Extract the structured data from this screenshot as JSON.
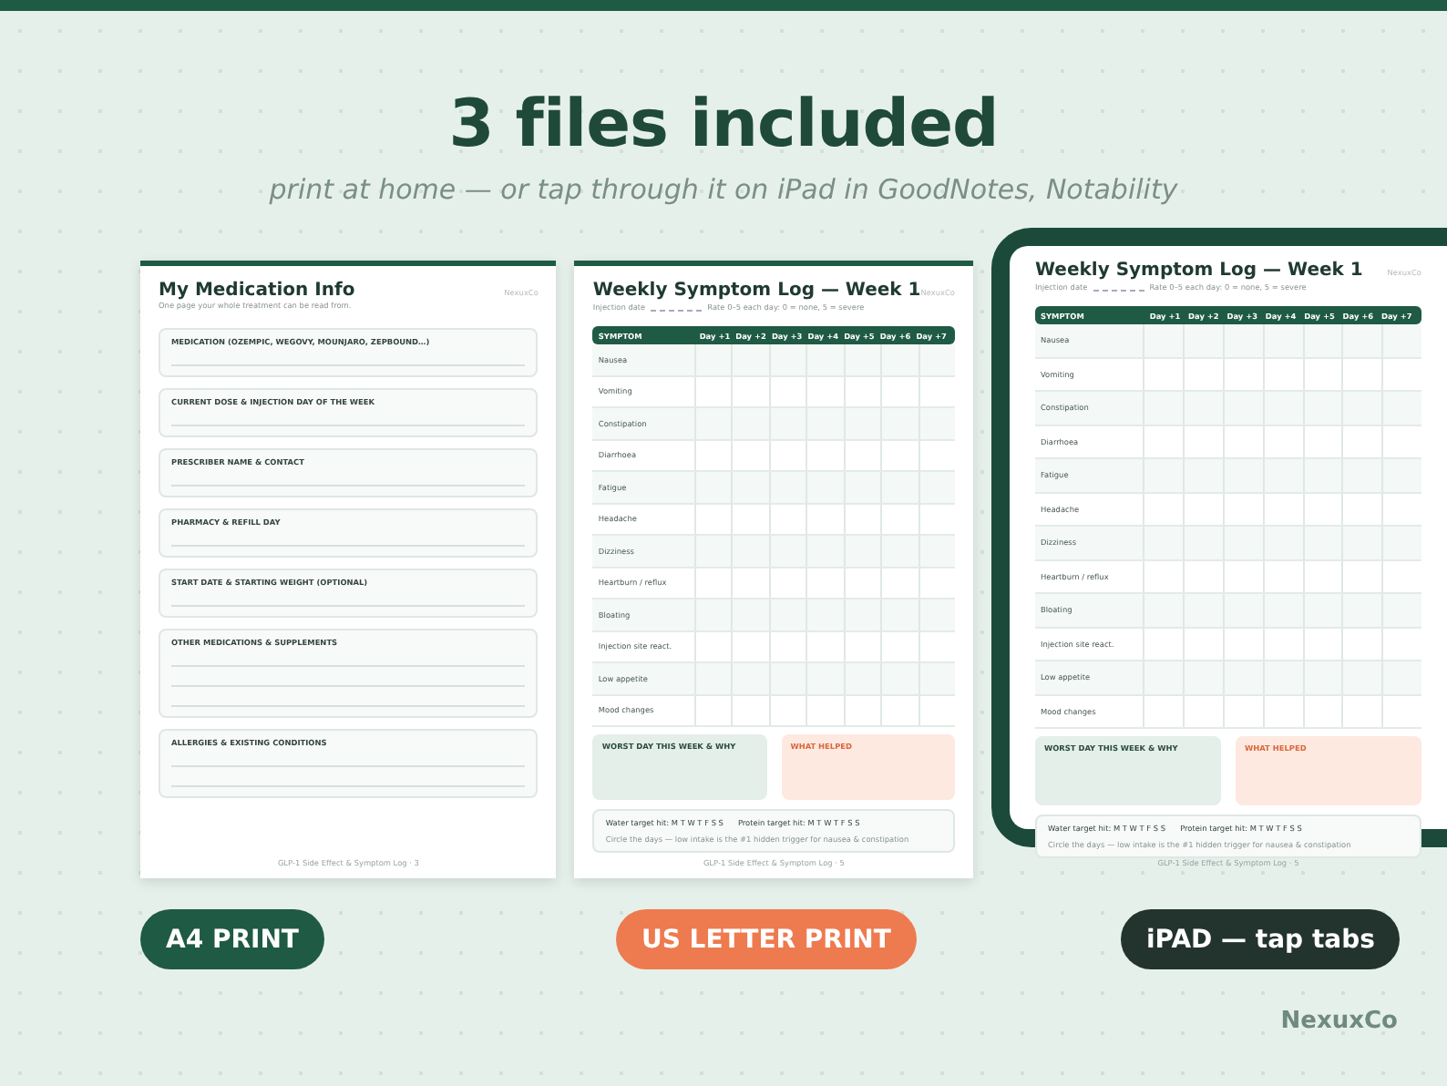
{
  "heading": {
    "title": "3 files included",
    "subtitle": "print at home — or tap through it on iPad in GoodNotes, Notability"
  },
  "pages": [
    {
      "kind": "info",
      "tag": "NexuxCo",
      "title": "My Medication Info",
      "subtitle": "One page your whole treatment can be read from.",
      "fields": [
        {
          "label": "MEDICATION (OZEMPIC, WEGOVY, MOUNJARO, ZEPBOUND…)",
          "kind": "short"
        },
        {
          "label": "CURRENT DOSE & INJECTION DAY OF THE WEEK",
          "kind": "short"
        },
        {
          "label": "PRESCRIBER NAME & CONTACT",
          "kind": "short"
        },
        {
          "label": "PHARMACY & REFILL DAY",
          "kind": "short"
        },
        {
          "label": "START DATE & STARTING WEIGHT (OPTIONAL)",
          "kind": "short"
        },
        {
          "label": "OTHER MEDICATIONS & SUPPLEMENTS",
          "kind": "long"
        },
        {
          "label": "ALLERGIES & EXISTING CONDITIONS",
          "kind": "medium"
        }
      ],
      "footer": "GLP-1 Side Effect & Symptom Log · 3"
    },
    {
      "kind": "log",
      "tag": "NexuxCo",
      "title": "Weekly Symptom Log — Week 1",
      "date_label": "Injection date",
      "rate_note": "Rate 0–5 each day: 0 = none, 5 = severe",
      "columns": [
        "SYMPTOM",
        "Day +1",
        "Day +2",
        "Day +3",
        "Day +4",
        "Day +5",
        "Day +6",
        "Day +7"
      ],
      "rows": [
        "Nausea",
        "Vomiting",
        "Constipation",
        "Diarrhoea",
        "Fatigue",
        "Headache",
        "Dizziness",
        "Heartburn / reflux",
        "Bloating",
        "Injection site react.",
        "Low appetite",
        "Mood changes"
      ],
      "boxes": [
        {
          "title": "WORST DAY THIS WEEK & WHY",
          "color": "#e3efe8"
        },
        {
          "title": "WHAT HELPED",
          "color": "#fde9df"
        }
      ],
      "targets": [
        "Water target hit: M T W T F S S",
        "Protein target hit: M T W T F S S"
      ],
      "note": "Circle the days — low intake is the #1 hidden trigger for nausea & constipation",
      "footer": "GLP-1 Side Effect & Symptom Log · 5"
    },
    {
      "kind": "tablet_log",
      "tag": "NexuxCo",
      "title": "Weekly Symptom Log — Week 1",
      "date_label": "Injection date",
      "rate_note": "Rate 0–5 each day: 0 = none, 5 = severe",
      "columns": [
        "SYMPTOM",
        "Day +1",
        "Day +2",
        "Day +3",
        "Day +4",
        "Day +5",
        "Day +6",
        "Day +7"
      ],
      "rows": [
        "Nausea",
        "Vomiting",
        "Constipation",
        "Diarrhoea",
        "Fatigue",
        "Headache",
        "Dizziness",
        "Heartburn / reflux",
        "Bloating",
        "Injection site react.",
        "Low appetite",
        "Mood changes"
      ],
      "boxes": [
        {
          "title": "WORST DAY THIS WEEK & WHY",
          "color": "#e3efe8"
        },
        {
          "title": "WHAT HELPED",
          "color": "#fde9df"
        }
      ],
      "targets": [
        "Water target hit: M T W T F S S",
        "Protein target hit: M T W T F S S"
      ],
      "note": "Circle the days — low intake is the #1 hidden trigger for nausea & constipation",
      "footer": "GLP-1 Side Effect & Symptom Log · 5"
    }
  ],
  "badges": [
    {
      "label": "A4 PRINT",
      "color": "#1f5a44"
    },
    {
      "label": "US LETTER PRINT",
      "color": "#ee7a4f"
    },
    {
      "label": "iPAD — tap tabs",
      "color": "#23332d"
    }
  ],
  "brand": "NexuxCo"
}
